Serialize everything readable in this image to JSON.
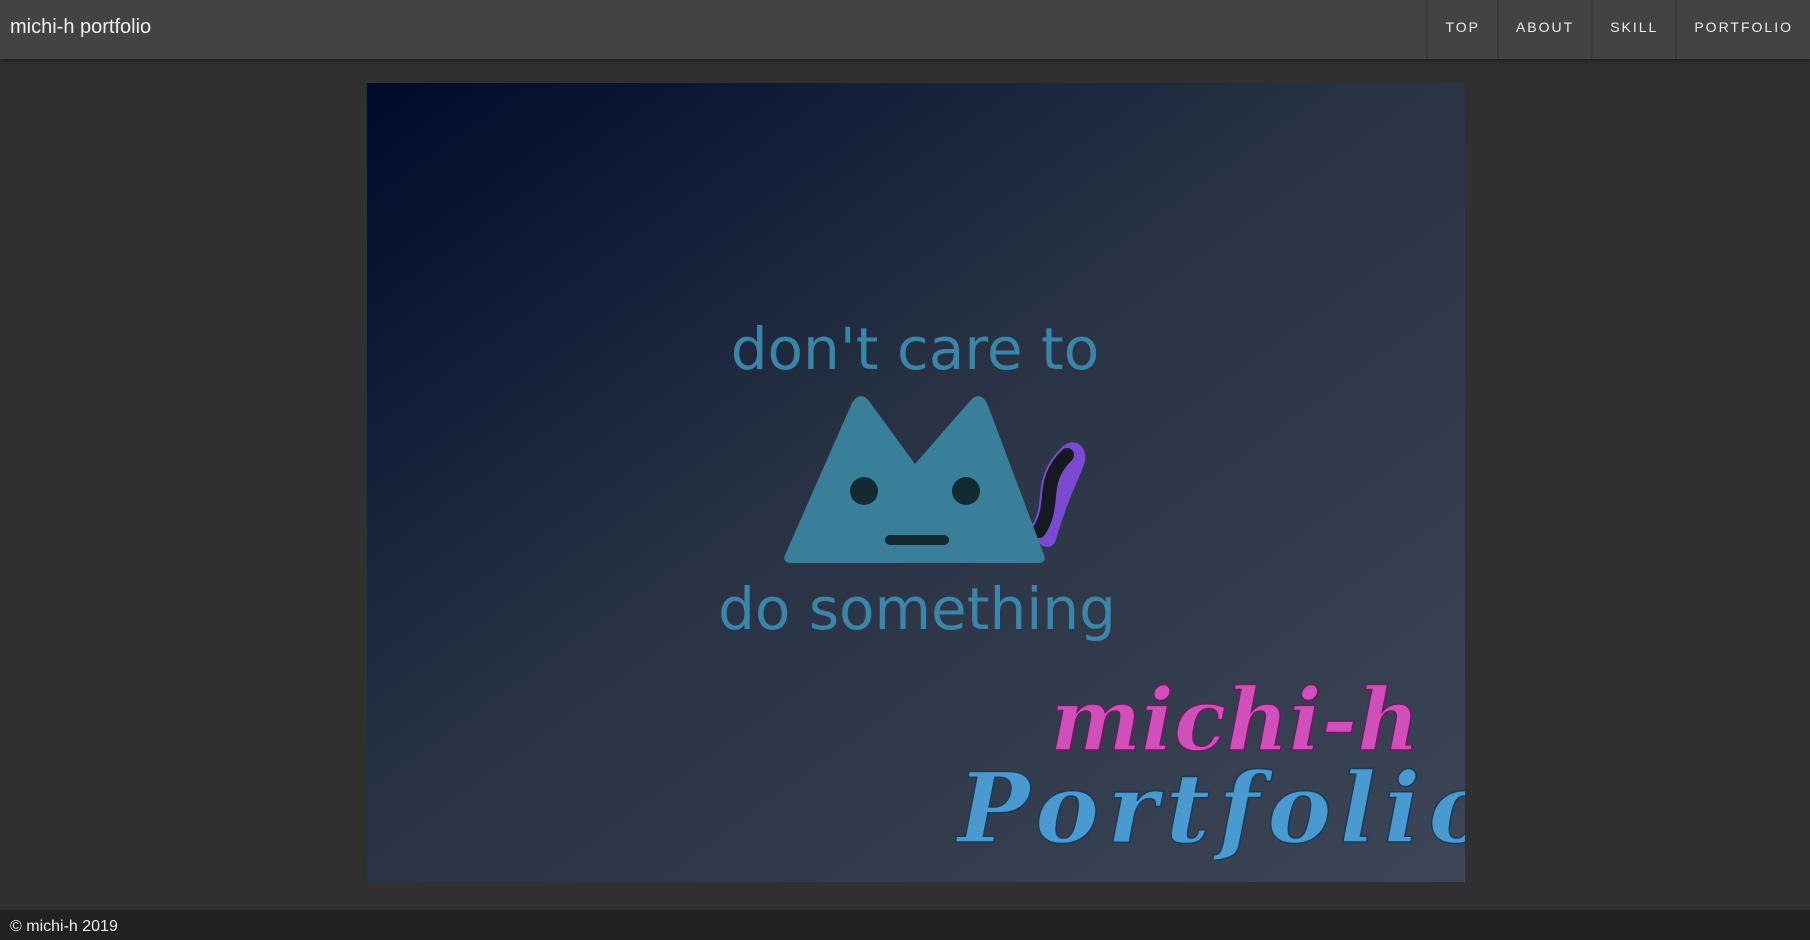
{
  "header": {
    "title": "michi-h portfolio"
  },
  "nav": [
    {
      "label": "TOP"
    },
    {
      "label": "ABOUT"
    },
    {
      "label": "SKILL"
    },
    {
      "label": "PORTFOLIO"
    }
  ],
  "hero": {
    "line1": "don't care to",
    "line2": "do something",
    "name": "michi-h",
    "subtitle": "Portfolio",
    "colors": {
      "gradient_start": "#000a2c",
      "gradient_end": "#3b4454",
      "cat": "#3a7f99",
      "text": "#3b85a8",
      "name": "#d04fb8",
      "subtitle": "#4a9ad0"
    }
  },
  "footer": {
    "copyright": "© michi-h 2019"
  }
}
